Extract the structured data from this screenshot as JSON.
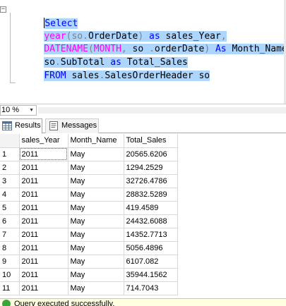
{
  "editor": {
    "lines": [
      [
        {
          "t": "Select",
          "c": "kw"
        }
      ],
      [
        {
          "t": "year",
          "c": "fn"
        },
        {
          "t": "(so",
          "c": "gr"
        },
        {
          "t": ".",
          "c": "gr"
        },
        {
          "t": "OrderDate",
          "c": ""
        },
        {
          "t": ")",
          "c": "gr"
        },
        {
          "t": " as ",
          "c": "kw"
        },
        {
          "t": "sales_Year",
          "c": ""
        },
        {
          "t": ",",
          "c": "gr"
        }
      ],
      [
        {
          "t": "DATENAME",
          "c": "fn"
        },
        {
          "t": "(",
          "c": "gr"
        },
        {
          "t": "MONTH",
          "c": "fn"
        },
        {
          "t": ",",
          "c": "gr"
        },
        {
          "t": " so ",
          "c": ""
        },
        {
          "t": ".",
          "c": "gr"
        },
        {
          "t": "orderDate",
          "c": ""
        },
        {
          "t": ")",
          "c": "gr"
        },
        {
          "t": " As ",
          "c": "kw"
        },
        {
          "t": "Month_Name",
          "c": ""
        },
        {
          "t": ",",
          "c": "gr"
        }
      ],
      [
        {
          "t": "so",
          "c": ""
        },
        {
          "t": ".",
          "c": "gr"
        },
        {
          "t": "SubTotal",
          "c": ""
        },
        {
          "t": " as ",
          "c": "kw"
        },
        {
          "t": "Total_Sales",
          "c": ""
        }
      ],
      [
        {
          "t": "FROM",
          "c": "kw"
        },
        {
          "t": " sales",
          "c": ""
        },
        {
          "t": ".",
          "c": "gr"
        },
        {
          "t": "SalesOrderHeader so",
          "c": ""
        }
      ]
    ]
  },
  "zoom": {
    "value": "10 %"
  },
  "tabs": {
    "results": "Results",
    "messages": "Messages"
  },
  "grid": {
    "columns": [
      "sales_Year",
      "Month_Name",
      "Total_Sales"
    ],
    "rows": [
      {
        "n": "1",
        "year": "2011",
        "month": "May",
        "total": "20565.6206"
      },
      {
        "n": "2",
        "year": "2011",
        "month": "May",
        "total": "1294.2529"
      },
      {
        "n": "3",
        "year": "2011",
        "month": "May",
        "total": "32726.4786"
      },
      {
        "n": "4",
        "year": "2011",
        "month": "May",
        "total": "28832.5289"
      },
      {
        "n": "5",
        "year": "2011",
        "month": "May",
        "total": "419.4589"
      },
      {
        "n": "6",
        "year": "2011",
        "month": "May",
        "total": "24432.6088"
      },
      {
        "n": "7",
        "year": "2011",
        "month": "May",
        "total": "14352.7713"
      },
      {
        "n": "8",
        "year": "2011",
        "month": "May",
        "total": "5056.4896"
      },
      {
        "n": "9",
        "year": "2011",
        "month": "May",
        "total": "6107.082"
      },
      {
        "n": "10",
        "year": "2011",
        "month": "May",
        "total": "35944.1562"
      },
      {
        "n": "11",
        "year": "2011",
        "month": "May",
        "total": "714.7043"
      }
    ]
  },
  "status": {
    "text": "Query executed successfully."
  },
  "colors": {
    "keyword": "#0000ff",
    "function": "#ff00ff",
    "operator": "#808080",
    "selection": "#add6ff",
    "success": "#3aa63a"
  }
}
